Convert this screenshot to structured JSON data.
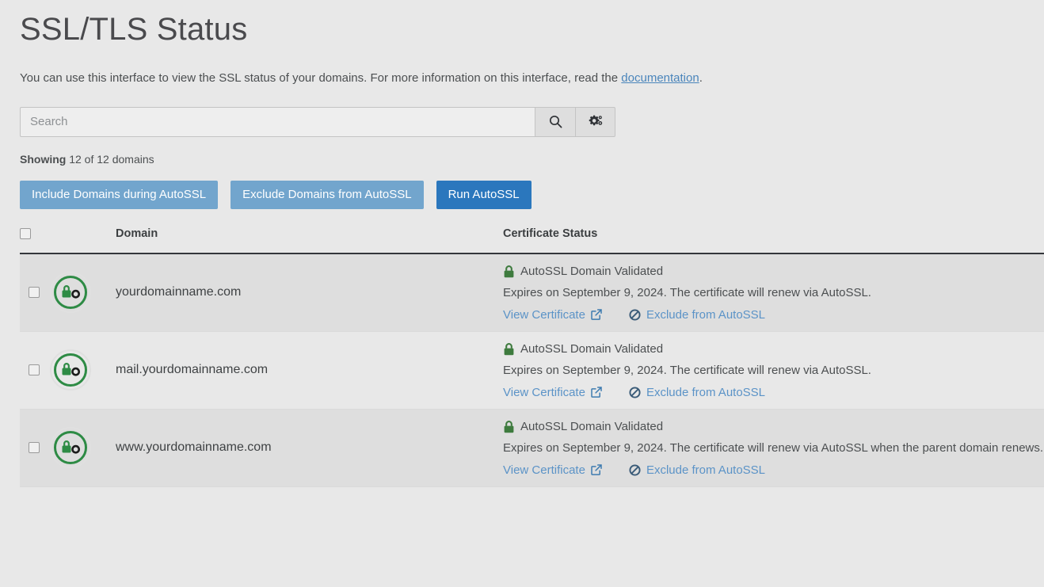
{
  "page": {
    "title": "SSL/TLS Status",
    "description_before": "You can use this interface to view the SSL status of your domains. For more information on this interface, read the ",
    "description_link": "documentation",
    "description_after": "."
  },
  "search": {
    "placeholder": "Search",
    "value": "",
    "search_button_icon": "search-icon",
    "settings_button_icon": "gears-icon"
  },
  "showing": {
    "label": "Showing",
    "text": "12 of 12 domains",
    "shown_count": 12,
    "total_count": 12
  },
  "actions": {
    "include": "Include Domains during AutoSSL",
    "exclude": "Exclude Domains from AutoSSL",
    "run": "Run AutoSSL"
  },
  "table": {
    "headers": {
      "select_all": "",
      "icon": "",
      "domain": "Domain",
      "status": "Certificate Status"
    },
    "rows": [
      {
        "checked": false,
        "icon": "ssl-lock-valid-icon",
        "domain": "yourdomainname.com",
        "status_title": "AutoSSL Domain Validated",
        "status_detail": "Expires on September 9, 2024. The certificate will renew via AutoSSL.",
        "view_link": "View Certificate",
        "exclude_link": "Exclude from AutoSSL",
        "wrap": false
      },
      {
        "checked": false,
        "icon": "ssl-lock-valid-icon",
        "domain": "mail.yourdomainname.com",
        "status_title": "AutoSSL Domain Validated",
        "status_detail": "Expires on September 9, 2024. The certificate will renew via AutoSSL.",
        "view_link": "View Certificate",
        "exclude_link": "Exclude from AutoSSL",
        "wrap": false
      },
      {
        "checked": false,
        "icon": "ssl-lock-valid-icon",
        "domain": "www.yourdomainname.com",
        "status_title": "AutoSSL Domain Validated",
        "status_detail": "Expires on September 9, 2024. The certificate will renew via AutoSSL when the parent domain renews.",
        "view_link": "View Certificate",
        "exclude_link": "Exclude from AutoSSL",
        "wrap": true
      }
    ]
  },
  "colors": {
    "page_background": "#e8e8e8",
    "row_odd": "#dedede",
    "row_even": "#e8e8e8",
    "primary_button": "#2b77bd",
    "secondary_button": "#72a5cd",
    "link": "#5b93c7",
    "valid_green": "#2e8b45",
    "lock_green": "#3e7b3e",
    "header_rule": "#33363a"
  }
}
